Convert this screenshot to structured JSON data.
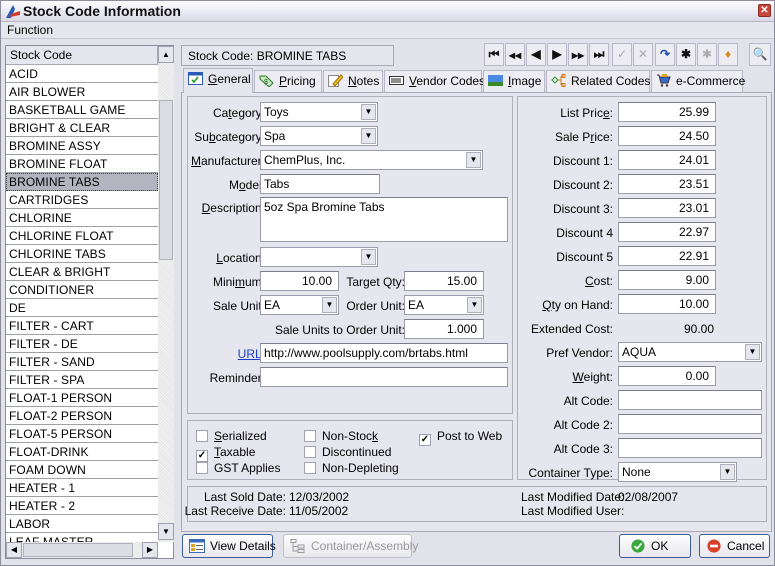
{
  "window": {
    "title": "Stock Code Information",
    "close_icon": "close-icon"
  },
  "menu": {
    "items": [
      {
        "label": "Function"
      }
    ]
  },
  "stock_list": {
    "header": "Stock Code",
    "selected": "BROMINE TABS",
    "items": [
      "ACID",
      "AIR BLOWER",
      "BASKETBALL GAME",
      "BRIGHT & CLEAR",
      "BROMINE ASSY",
      "BROMINE FLOAT",
      "BROMINE TABS",
      "CARTRIDGES",
      "CHLORINE",
      "CHLORINE FLOAT",
      "CHLORINE TABS",
      "CLEAR & BRIGHT",
      "CONDITIONER",
      "DE",
      "FILTER - CART",
      "FILTER - DE",
      "FILTER - SAND",
      "FILTER - SPA",
      "FLOAT-1 PERSON",
      "FLOAT-2 PERSON",
      "FLOAT-5 PERSON",
      "FLOAT-DRINK",
      "FOAM DOWN",
      "HEATER - 1",
      "HEATER - 2",
      "LABOR",
      "LEAF MASTER"
    ]
  },
  "stock_code_display": "Stock Code: BROMINE TABS",
  "toolbar": {
    "buttons": [
      {
        "name": "first-record",
        "glyph": "⏮",
        "enabled": true
      },
      {
        "name": "page-back",
        "glyph": "◀◀",
        "enabled": true
      },
      {
        "name": "previous-record",
        "glyph": "◀",
        "enabled": true
      },
      {
        "name": "next-record",
        "glyph": "▶",
        "enabled": true
      },
      {
        "name": "page-forward",
        "glyph": "▶▶",
        "enabled": true
      },
      {
        "name": "last-record",
        "glyph": "⏭",
        "enabled": true
      },
      {
        "name": "save",
        "glyph": "✓",
        "enabled": false
      },
      {
        "name": "cancel-edit",
        "glyph": "✕",
        "enabled": false
      },
      {
        "name": "refresh",
        "glyph": "↷",
        "enabled": true
      },
      {
        "name": "new-record",
        "glyph": "✱",
        "enabled": true
      },
      {
        "name": "copy-record",
        "glyph": "✱",
        "enabled": false
      },
      {
        "name": "filter",
        "glyph": "♦",
        "enabled": true
      },
      {
        "name": "search",
        "glyph": "🔍",
        "enabled": true
      }
    ]
  },
  "tabs": [
    {
      "label": "General",
      "underline": "G",
      "active": true
    },
    {
      "label": "Pricing",
      "underline": "P",
      "active": false
    },
    {
      "label": "Notes",
      "underline": "N",
      "active": false
    },
    {
      "label": "Vendor Codes",
      "underline": "V",
      "active": false
    },
    {
      "label": "Image",
      "underline": "I",
      "active": false
    },
    {
      "label": "Related Codes",
      "underline": "",
      "active": false
    },
    {
      "label": "e-Commerce",
      "underline": "",
      "active": false
    }
  ],
  "general": {
    "category": {
      "label": "Category:",
      "value": "Toys"
    },
    "subcategory": {
      "label": "Subcategory:",
      "value": "Spa"
    },
    "manufacturer": {
      "label": "Manufacturer:",
      "value": "ChemPlus, Inc."
    },
    "model": {
      "label": "Model:",
      "value": "Tabs"
    },
    "description": {
      "label": "Description:",
      "value": "5oz Spa Bromine Tabs"
    },
    "location": {
      "label": "Location:",
      "value": ""
    },
    "minimum": {
      "label": "Minimum:",
      "value": "10.00"
    },
    "target_qty": {
      "label": "Target Qty:",
      "value": "15.00"
    },
    "sale_unit": {
      "label": "Sale Unit:",
      "value": "EA"
    },
    "order_unit": {
      "label": "Order Unit:",
      "value": "EA"
    },
    "sale_to_order": {
      "label": "Sale Units to Order Unit:",
      "value": "1.000"
    },
    "url": {
      "label": "URL:",
      "value": "http://www.poolsupply.com/brtabs.html"
    },
    "reminder": {
      "label": "Reminder:",
      "value": ""
    }
  },
  "pricing": {
    "list_price": {
      "label": "List Price:",
      "value": "25.99"
    },
    "sale_price": {
      "label": "Sale Price:",
      "value": "24.50"
    },
    "discount1": {
      "label": "Discount 1:",
      "value": "24.01"
    },
    "discount2": {
      "label": "Discount 2:",
      "value": "23.51"
    },
    "discount3": {
      "label": "Discount 3:",
      "value": "23.01"
    },
    "discount4": {
      "label": "Discount 4",
      "value": "22.97"
    },
    "discount5": {
      "label": "Discount 5",
      "value": "22.91"
    },
    "cost": {
      "label": "Cost:",
      "value": "9.00"
    },
    "qty_on_hand": {
      "label": "Qty on Hand:",
      "value": "10.00"
    },
    "extended_cost": {
      "label": "Extended Cost:",
      "value": "90.00"
    },
    "pref_vendor": {
      "label": "Pref Vendor:",
      "value": "AQUA"
    },
    "weight": {
      "label": "Weight:",
      "value": "0.00"
    },
    "alt_code": {
      "label": "Alt Code:",
      "value": ""
    },
    "alt_code2": {
      "label": "Alt Code 2:",
      "value": ""
    },
    "alt_code3": {
      "label": "Alt Code 3:",
      "value": ""
    },
    "container_type": {
      "label": "Container Type:",
      "value": "None"
    }
  },
  "flags": {
    "serialized": {
      "label": "Serialized",
      "checked": false
    },
    "taxable": {
      "label": "Taxable",
      "checked": true
    },
    "gst_applies": {
      "label": "GST Applies",
      "checked": false
    },
    "non_stock": {
      "label": "Non-Stock",
      "checked": false
    },
    "discontinued": {
      "label": "Discontinued",
      "checked": false
    },
    "non_depleting": {
      "label": "Non-Depleting",
      "checked": false
    },
    "post_to_web": {
      "label": "Post to Web",
      "checked": true
    }
  },
  "history": {
    "last_sold_label": "Last Sold Date:",
    "last_sold": "12/03/2002",
    "last_receive_label": "Last Receive Date:",
    "last_receive": "11/05/2002",
    "last_modified_label": "Last Modified Date:",
    "last_modified": "02/08/2007",
    "last_modified_user_label": "Last Modified User:",
    "last_modified_user": ""
  },
  "footer": {
    "view_details": "View Details",
    "container_assembly": "Container/Assembly",
    "ok": "OK",
    "cancel": "Cancel"
  }
}
